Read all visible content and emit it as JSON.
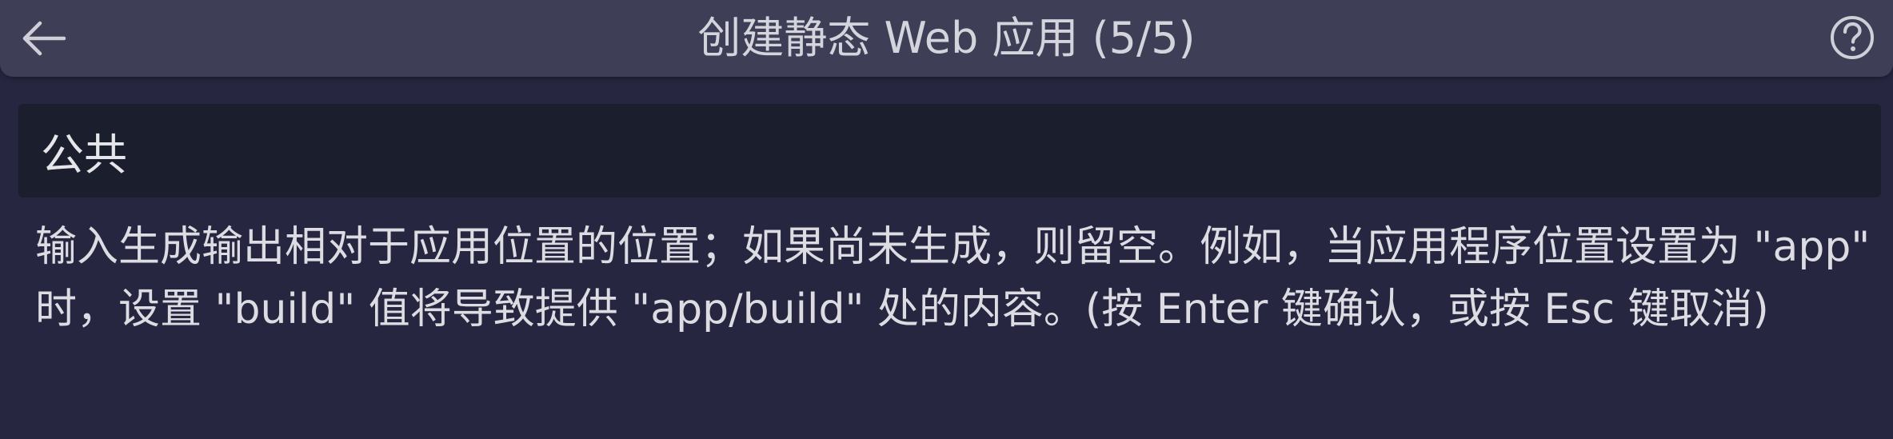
{
  "titlebar": {
    "title": "创建静态 Web 应用 (5/5)",
    "back_icon": "arrow-left-icon",
    "help_icon": "question-circle-icon"
  },
  "input": {
    "value": "公共",
    "placeholder": ""
  },
  "message": {
    "text": "输入生成输出相对于应用位置的位置；如果尚未生成，则留空。例如，当应用程序位置设置为 \"app\" 时，设置 \"build\" 值将导致提供 \"app/build\" 处的内容。(按 Enter 键确认，或按 Esc 键取消)"
  },
  "colors": {
    "background": "#262640",
    "titlebar": "#3e3e57",
    "input_background": "#1b1e2d",
    "text": "#dcdce2"
  }
}
